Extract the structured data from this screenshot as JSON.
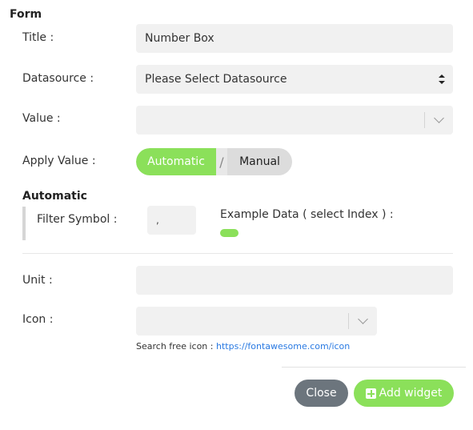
{
  "form": {
    "heading": "Form",
    "title_label": "Title :",
    "title_value": "Number Box",
    "datasource_label": "Datasource :",
    "datasource_selected": "Please Select Datasource",
    "value_label": "Value :",
    "value_selected": "",
    "apply_value_label": "Apply Value :",
    "apply_options": {
      "automatic": "Automatic",
      "separator": "/",
      "manual": "Manual"
    },
    "apply_selected": "Automatic",
    "automatic_section": {
      "heading": "Automatic",
      "filter_symbol_label": "Filter Symbol :",
      "filter_symbol_value": ",",
      "example_data_label": "Example Data ( select Index ) :"
    },
    "unit_label": "Unit :",
    "unit_value": "",
    "icon_label": "Icon :",
    "icon_selected": "",
    "icon_hint_prefix": "Search free icon :",
    "icon_hint_link": "https://fontawesome.com/icon"
  },
  "footer": {
    "close_label": "Close",
    "add_widget_label": "Add widget",
    "add_icon": "plus-square-icon"
  },
  "colors": {
    "accent": "#8be05a",
    "close_button": "#6c757d",
    "link": "#2a7ae2",
    "field_bg": "#f1f1f1"
  }
}
